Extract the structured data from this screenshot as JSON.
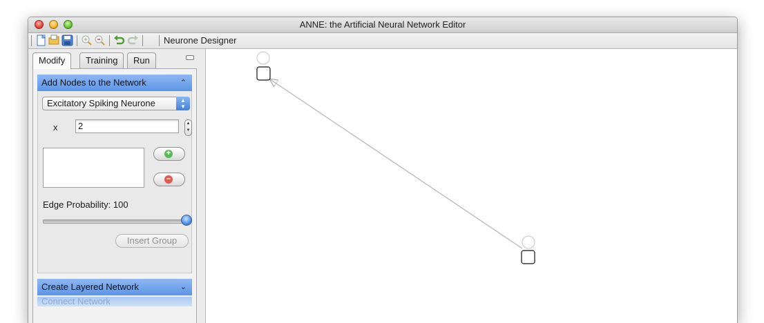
{
  "window": {
    "title": "ANNE: the Artificial Neural Network Editor"
  },
  "toolbar": {
    "label": "Neurone Designer",
    "buttons": [
      "new-file-icon",
      "open-folder-icon",
      "save-disk-icon",
      "zoom-in-icon",
      "zoom-out-icon",
      "undo-icon",
      "redo-icon"
    ]
  },
  "tabs": [
    "Modify",
    "Training",
    "Run"
  ],
  "add_nodes": {
    "header": "Add Nodes to the Network",
    "neurone_type": "Excitatory Spiking Neurone",
    "count_label": "x",
    "count_value": "2",
    "edge_probability_label": "Edge Probability:",
    "edge_probability_value": "100",
    "edge_probability": 100,
    "insert_label": "Insert Group"
  },
  "create_layered": {
    "header": "Create Layered Network"
  },
  "connect": {
    "header": "Connect Network"
  },
  "colors": {
    "accent": "#5d95e6",
    "add": "#5cb85c",
    "remove": "#e05a4f"
  }
}
